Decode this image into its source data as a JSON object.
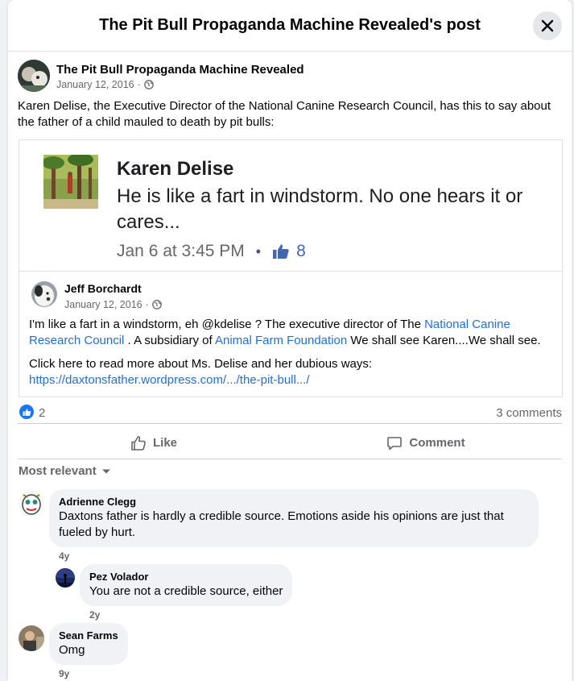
{
  "modal": {
    "title": "The Pit Bull Propaganda Machine Revealed's post"
  },
  "post": {
    "author": "The Pit Bull Propaganda Machine Revealed",
    "date": "January 12, 2016",
    "audience_icon": "globe-icon",
    "text": "Karen Delise, the Executive Director of the National Canine Research Council, has this to say about the father of a child mauled to death by pit bulls:"
  },
  "shared_image": {
    "name": "Karen Delise",
    "body": "He is like a fart in windstorm.  No one hears it or cares...",
    "time": "Jan 6 at 3:45 PM",
    "separator": "•",
    "like_count": "8"
  },
  "shared_post": {
    "author": "Jeff Borchardt",
    "date": "January 12, 2016",
    "text_before": "I'm like a fart in a windstorm, eh @kdelise ? The executive director of The ",
    "link1": "National Canine Research Council",
    "text_middle": " . A subsidiary of ",
    "link2": "Animal Farm Foundation",
    "text_after": " We shall see Karen....We shall see.",
    "click_text": "Click here to read more about Ms. Delise and her dubious ways:",
    "url": "https://daxtonsfather.wordpress.com/.../the-pit-bull.../"
  },
  "reactions": {
    "count": "2",
    "comments": "3 comments"
  },
  "actions": {
    "like": "Like",
    "comment": "Comment"
  },
  "sort": {
    "label": "Most relevant"
  },
  "comments": [
    {
      "author": "Adrienne Clegg",
      "text": "Daxtons father is hardly a credible source. Emotions aside his opinions are just that fueled by hurt.",
      "time": "4y"
    },
    {
      "author": "Pez Volador",
      "text": "You are not a credible source, either",
      "time": "2y"
    },
    {
      "author": "Sean Farms",
      "text": "Omg",
      "time": "9y"
    }
  ],
  "colors": {
    "accent": "#1877f2",
    "link": "#216fdb",
    "muted": "#65676b",
    "bubble": "#f0f2f5"
  }
}
